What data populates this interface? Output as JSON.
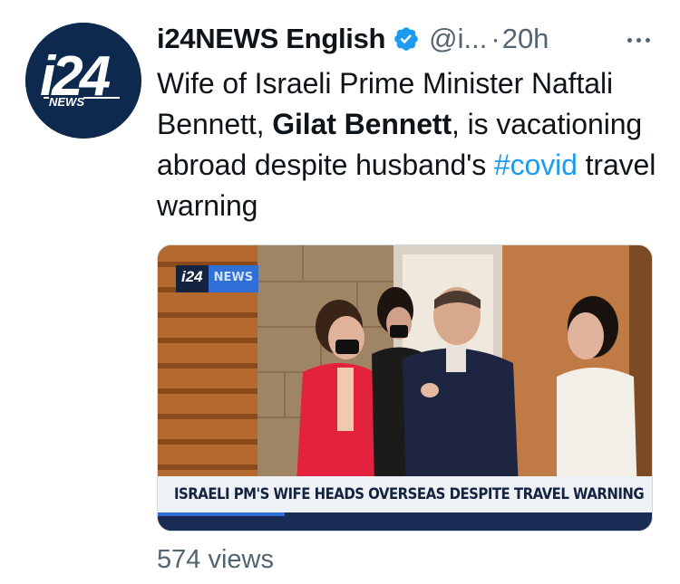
{
  "author": {
    "display_name": "i24NEWS English",
    "handle": "@i...",
    "separator": "·",
    "time": "20h",
    "verified": true,
    "avatar_logo_text": "i24",
    "avatar_logo_subtext": "NEWS"
  },
  "tweet": {
    "text_part1": "Wife of Israeli Prime Minister Naftali Bennett, ",
    "text_bold": "Gilat Bennett",
    "text_part2": ", is vacationing abroad despite husband's ",
    "hashtag": "#covid",
    "text_part3": " travel warning"
  },
  "media": {
    "chyron": "ISRAELI PM'S WIFE HEADS OVERSEAS DESPITE TRAVEL WARNING",
    "logo_main": "i24",
    "logo_side": "NEWS"
  },
  "footer": {
    "views": "574 views"
  },
  "colors": {
    "link": "#1d9bf0",
    "secondary_text": "#536471",
    "verified_badge": "#1d9bf0",
    "avatar_bg": "#0d2a4e"
  },
  "icons": {
    "verified": "verified-badge-icon",
    "more": "more-options-icon"
  }
}
